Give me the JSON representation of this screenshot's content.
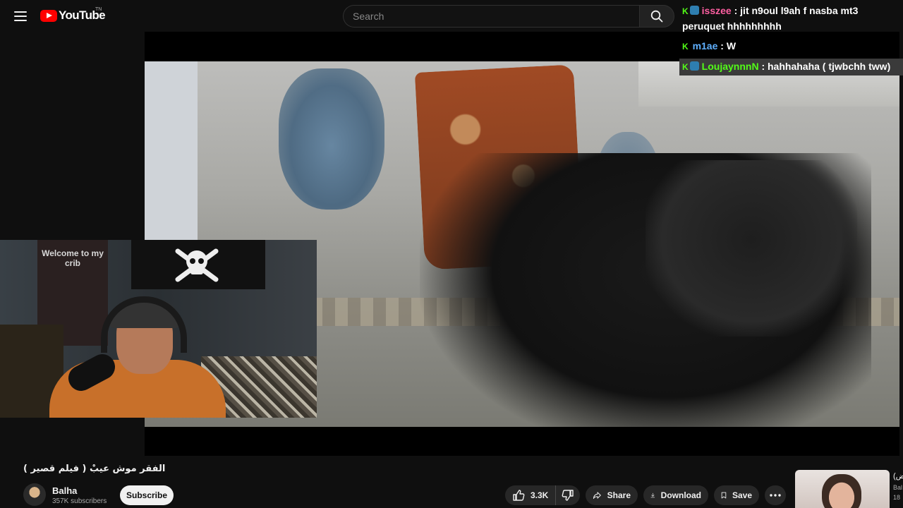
{
  "header": {
    "logo_text": "YouTube",
    "logo_tm": "TN",
    "search_placeholder": "Search"
  },
  "webcam": {
    "banner_text": "Welcome to  my crib"
  },
  "chat": {
    "messages": [
      {
        "user": "isszee",
        "user_color": "#ff5fa2",
        "text": ": jit n9oul l9ah f nasba mt3 peruquet hhhhhhhhh"
      },
      {
        "user": "m1ae",
        "user_color": "#5fb0ff",
        "text": ": W"
      },
      {
        "user": "LoujaynnnN",
        "user_color": "#53fc18",
        "text": ": hahhahaha ( tjwbchh tww)"
      }
    ]
  },
  "video": {
    "title": "الفقر موش عيبْ ( فيلم قصير )",
    "channel": "Balha",
    "subscribers": "357K subscribers",
    "subscribe_label": "Subscribe",
    "likes": "3.3K",
    "share_label": "Share",
    "download_label": "Download",
    "save_label": "Save"
  },
  "recommended": {
    "title_fragment": "(ض",
    "channel_fragment": "Bal",
    "meta_fragment": "18"
  },
  "colors": {
    "background": "#0f0f0f",
    "brand_red": "#ff0000",
    "kick_green": "#53fc18"
  }
}
